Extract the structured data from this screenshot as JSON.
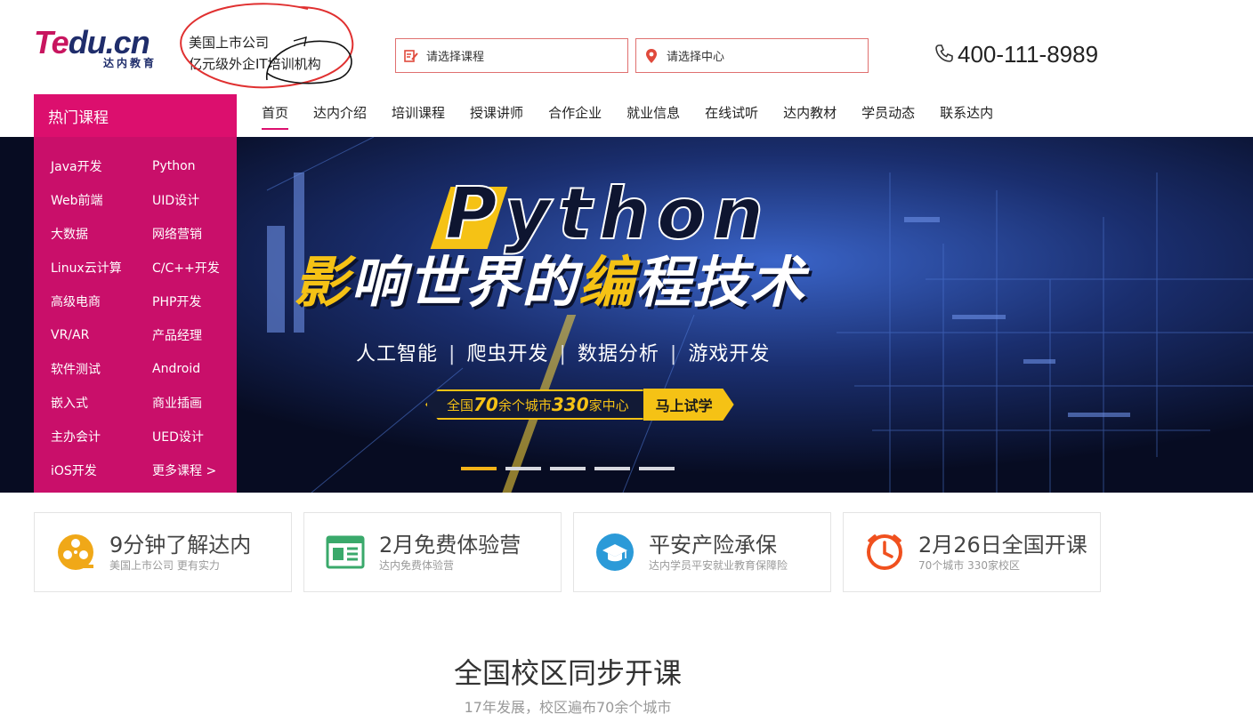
{
  "header": {
    "logo_part1": "Te",
    "logo_part2": "du.cn",
    "logo_sub": "达内教育",
    "slogan_line1": "美国上市公司",
    "slogan_line2": "亿元级外企IT培训机构",
    "course_select_placeholder": "请选择课程",
    "center_select_placeholder": "请选择中心",
    "phone": "400-111-8989"
  },
  "nav": {
    "hot_courses_title": "热门课程",
    "items": [
      "首页",
      "达内介绍",
      "培训课程",
      "授课讲师",
      "合作企业",
      "就业信息",
      "在线试听",
      "达内教材",
      "学员动态",
      "联系达内"
    ],
    "active_index": 0
  },
  "courses": [
    "Java开发",
    "Python",
    "Web前端",
    "UID设计",
    "大数据",
    "网络营销",
    "Linux云计算",
    "C/C++开发",
    "高级电商",
    "PHP开发",
    "VR/AR",
    "产品经理",
    "软件测试",
    "Android",
    "嵌入式",
    "商业插画",
    "主办会计",
    "UED设计",
    "iOS开发",
    "更多课程 >"
  ],
  "banner": {
    "title_en": "Python",
    "headline_part1": "影",
    "headline_part2": "响世界的",
    "headline_part3": "编",
    "headline_part4": "程技术",
    "tags": [
      "人工智能",
      "爬虫开发",
      "数据分析",
      "游戏开发"
    ],
    "tag_separator": "|",
    "cta_pre": "全国",
    "cta_num1": "70",
    "cta_mid": "余个城市",
    "cta_num2": "330",
    "cta_post": "家中心",
    "cta_button": "马上试学",
    "slide_count": 5,
    "active_slide": 0
  },
  "features": [
    {
      "title": "9分钟了解达内",
      "sub": "美国上市公司 更有实力",
      "icon": "film-reel-icon",
      "color": "#f0a818"
    },
    {
      "title": "2月免费体验营",
      "sub": "达内免费体验营",
      "icon": "newspaper-icon",
      "color": "#3aa96b"
    },
    {
      "title": "平安产险承保",
      "sub": "达内学员平安就业教育保障险",
      "icon": "graduation-cap-icon",
      "color": "#2b9ad8"
    },
    {
      "title": "2月26日全国开课",
      "sub": "70个城市 330家校区",
      "icon": "clock-icon",
      "color": "#f0501e"
    }
  ],
  "section": {
    "title": "全国校区同步开课",
    "subtitle": "17年发展，校区遍布70余个城市"
  },
  "colors": {
    "brand": "#dc0f6e",
    "menu_bg": "#c90f6a",
    "accent_yellow": "#f5c215",
    "banner_bg": "#0a1028"
  }
}
